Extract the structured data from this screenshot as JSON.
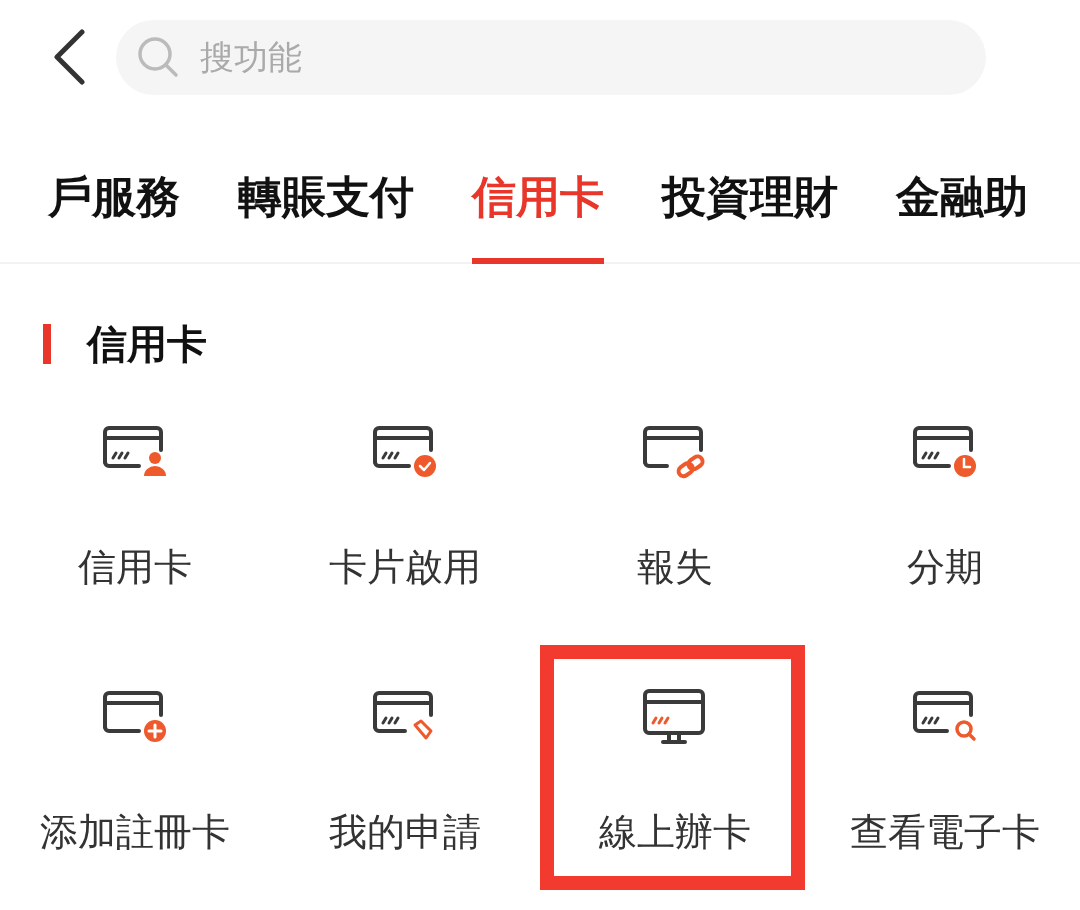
{
  "search": {
    "placeholder": "搜功能"
  },
  "tabs": [
    {
      "label": "戶服務",
      "selected": false
    },
    {
      "label": "轉賬支付",
      "selected": false
    },
    {
      "label": "信用卡",
      "selected": true
    },
    {
      "label": "投資理財",
      "selected": false
    },
    {
      "label": "金融助",
      "selected": false
    }
  ],
  "section": {
    "title": "信用卡"
  },
  "items": [
    {
      "label": "信用卡",
      "kind": "user",
      "highlighted": false
    },
    {
      "label": "卡片啟用",
      "kind": "check",
      "highlighted": false
    },
    {
      "label": "報失",
      "kind": "link",
      "highlighted": false
    },
    {
      "label": "分期",
      "kind": "clock",
      "highlighted": false
    },
    {
      "label": "添加註冊卡",
      "kind": "plus",
      "highlighted": false
    },
    {
      "label": "我的申請",
      "kind": "tag",
      "highlighted": false
    },
    {
      "label": "線上辦卡",
      "kind": "monitor",
      "highlighted": true
    },
    {
      "label": "查看電子卡",
      "kind": "search",
      "highlighted": false
    }
  ]
}
